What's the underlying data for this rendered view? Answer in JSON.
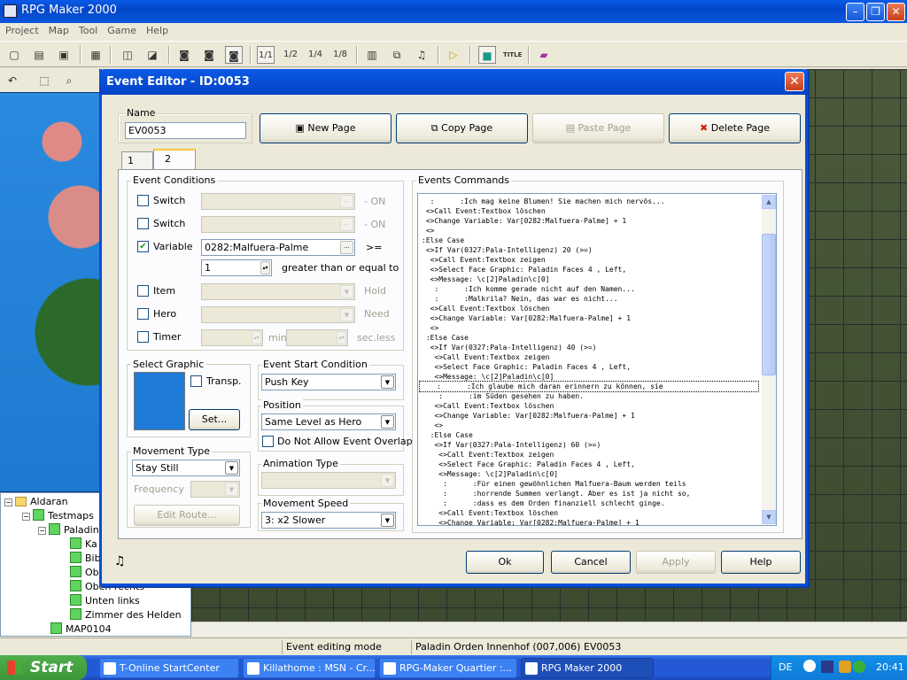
{
  "app": {
    "title": "RPG Maker 2000"
  },
  "menu": [
    "Project",
    "Map",
    "Tool",
    "Game",
    "Help"
  ],
  "toolbar": {
    "zoom": [
      "1/1",
      "1/2",
      "1/4",
      "1/8"
    ],
    "title_label": "TITLE"
  },
  "tree": {
    "items": [
      {
        "label": "Aldaran",
        "type": "folder"
      },
      {
        "label": "Testmaps",
        "type": "map"
      },
      {
        "label": "Paladin",
        "type": "map"
      },
      {
        "label": "Ka",
        "type": "map"
      },
      {
        "label": "Bib",
        "type": "map"
      },
      {
        "label": "Ob",
        "type": "map"
      },
      {
        "label": "Oben rechts",
        "type": "map"
      },
      {
        "label": "Unten links",
        "type": "map"
      },
      {
        "label": "Zimmer des Helden",
        "type": "map"
      },
      {
        "label": "MAP0104",
        "type": "map"
      }
    ]
  },
  "status": {
    "mode": "Event editing mode",
    "location": "Paladin Orden Innenhof (007,006) EV0053"
  },
  "taskbar": {
    "start": "Start",
    "tasks": [
      "T-Online StartCenter",
      "Killathome : MSN - Cr...",
      "RPG-Maker Quartier :...",
      "RPG Maker 2000"
    ],
    "lang": "DE",
    "clock": "20:41"
  },
  "dialog": {
    "title": "Event Editor - ID:0053",
    "name_label": "Name",
    "name_value": "EV0053",
    "buttons": {
      "new_page": "New Page",
      "copy_page": "Copy Page",
      "paste_page": "Paste Page",
      "delete_page": "Delete Page"
    },
    "tabs": [
      "1",
      "2"
    ],
    "conditions": {
      "label": "Event Conditions",
      "switch_label": "Switch",
      "on_text": "- ON",
      "variable_label": "Variable",
      "variable_value": "0282:Malfuera-Palme",
      "ge_sign": ">=",
      "variable_number": "1",
      "ge_text": "greater than or equal to",
      "item_label": "Item",
      "hold_text": "Hold",
      "hero_label": "Hero",
      "need_text": "Need",
      "timer_label": "Timer",
      "min_text": "min",
      "sec_text": "sec.less"
    },
    "graphic": {
      "label": "Select Graphic",
      "transp": "Transp.",
      "set": "Set..."
    },
    "start_condition": {
      "label": "Event Start Condition",
      "value": "Push Key"
    },
    "position": {
      "label": "Position",
      "value": "Same Level as Hero",
      "overlap": "Do Not Allow Event Overlap"
    },
    "movement_type": {
      "label": "Movement Type",
      "value": "Stay Still",
      "frequency": "Frequency",
      "edit_route": "Edit Route..."
    },
    "animation_type": {
      "label": "Animation Type"
    },
    "movement_speed": {
      "label": "Movement Speed",
      "value": "3: x2 Slower"
    },
    "commands": {
      "label": "Events Commands",
      "lines": [
        "  :      :Ich mag keine Blumen! Sie machen mich nervös...",
        " <>Call Event:Textbox löschen",
        " <>Change Variable: Var[0282:Malfuera-Palme] + 1",
        " <>",
        ":Else Case",
        " <>If Var(0327:Pala-Intelligenz) 20 (>=)",
        "  <>Call Event:Textbox zeigen",
        "  <>Select Face Graphic: Paladin Faces 4 , Left,",
        "  <>Message: \\c[2]Paladin\\c[0]",
        "   :      :Ich komme gerade nicht auf den Namen...",
        "   :      :Malkrila? Nein, das war es nicht...",
        "  <>Call Event:Textbox löschen",
        "  <>Change Variable: Var[0282:Malfuera-Palme] + 1",
        "  <>",
        " :Else Case",
        "  <>If Var(0327:Pala-Intelligenz) 40 (>=)",
        "   <>Call Event:Textbox zeigen",
        "   <>Select Face Graphic: Paladin Faces 4 , Left,",
        "   <>Message: \\c[2]Paladin\\c[0]",
        "    :      :Ich glaube mich daran erinnern zu können, sie",
        "    :      :im Süden gesehen zu haben.",
        "   <>Call Event:Textbox löschen",
        "   <>Change Variable: Var[0282:Malfuera-Palme] + 1",
        "   <>",
        "  :Else Case",
        "   <>If Var(0327:Pala-Intelligenz) 60 (>=)",
        "    <>Call Event:Textbox zeigen",
        "    <>Select Face Graphic: Paladin Faces 4 , Left,",
        "    <>Message: \\c[2]Paladin\\c[0]",
        "     :      :Für einen gewöhnlichen Malfuera-Baum werden teils",
        "     :      :horrende Summen verlangt. Aber es ist ja nicht so,",
        "     :      :dass es dem Orden finanziell schlecht ginge.",
        "    <>Call Event:Textbox löschen",
        "    <>Change Variable: Var[0282:Malfuera-Palme] + 1"
      ],
      "selected_index": 19
    },
    "footer": {
      "ok": "Ok",
      "cancel": "Cancel",
      "apply": "Apply",
      "help": "Help"
    }
  }
}
